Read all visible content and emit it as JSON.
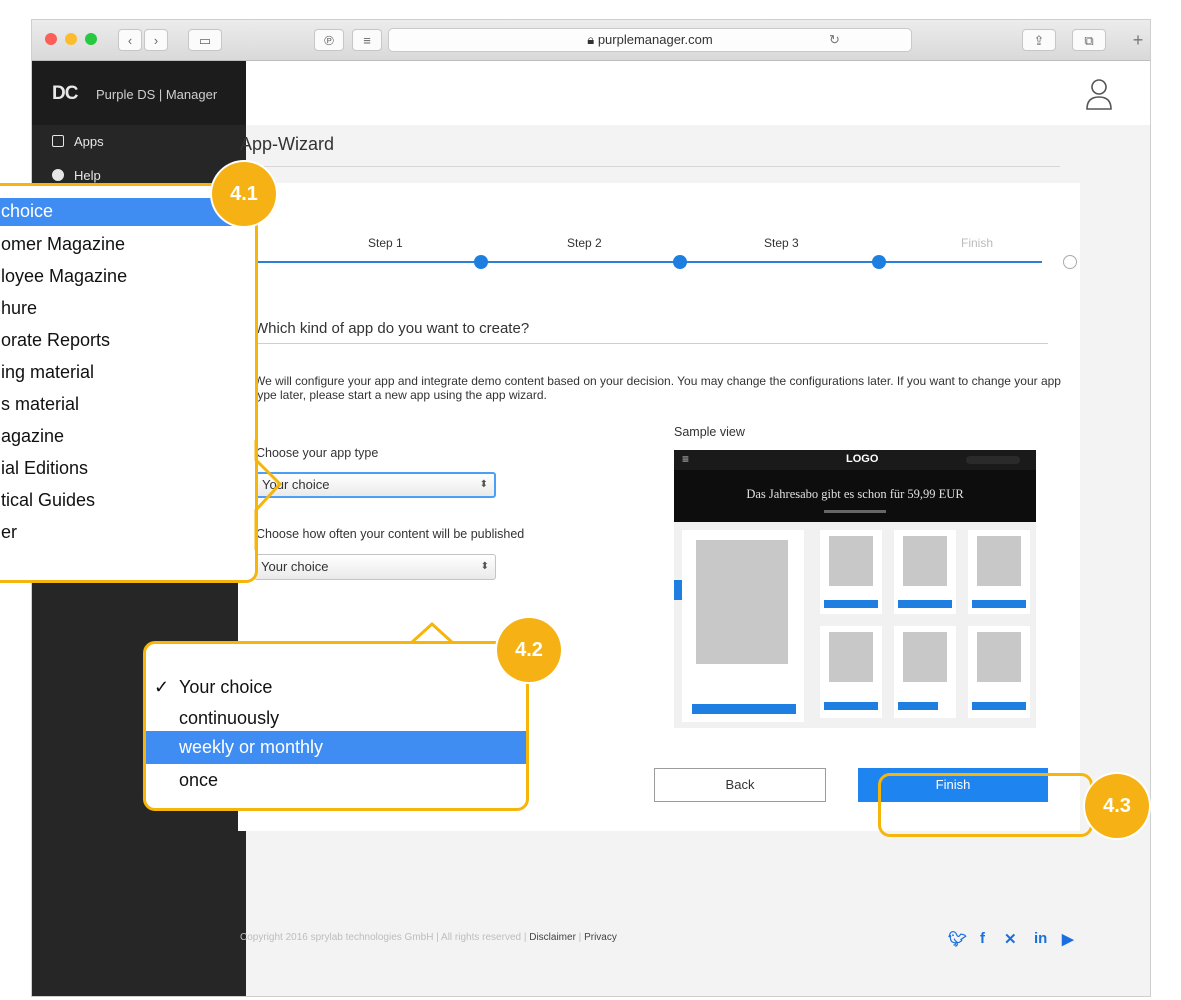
{
  "browser": {
    "url": "purplemanager.com"
  },
  "sidebar": {
    "logo_mark": "DC",
    "logo_text": "Purple DS | Manager",
    "items": [
      {
        "label": "Apps"
      },
      {
        "label": "Help"
      }
    ]
  },
  "main": {
    "title": "App-Wizard",
    "steps": [
      "Step 1",
      "Step 2",
      "Step 3",
      "Finish"
    ],
    "question": "Which kind of app do you want to create?",
    "description": "We will configure your app and integrate demo content based on your decision. You may change the configurations later. If you want to change your app type later, please start a new app using the app wizard.",
    "app_type_label": "Choose your app type",
    "app_type_value": "Your choice",
    "frequency_label": "Choose how often your content will be published",
    "frequency_value": "Your choice",
    "sample_label": "Sample view",
    "sample": {
      "logo": "LOGO",
      "banner": "Das Jahresabo gibt es schon für 59,99 EUR"
    },
    "back_label": "Back",
    "finish_label": "Finish"
  },
  "footer": {
    "copyright": "Copyright 2016 sprylab technologies GmbH | All rights reserved | ",
    "disclaimer": "Disclaimer",
    "separator": " | ",
    "privacy": "Privacy"
  },
  "callout_app_type": {
    "badge": "4.1",
    "options": [
      "choice",
      "omer Magazine",
      "loyee Magazine",
      "hure",
      "orate Reports",
      "ing material",
      "s material",
      "agazine",
      "ial Editions",
      "tical Guides",
      "er"
    ],
    "selected_index": 0
  },
  "callout_frequency": {
    "badge": "4.2",
    "checkmark": "✓",
    "options": [
      "Your choice",
      "continuously",
      "weekly or monthly",
      "once"
    ],
    "checked_index": 0,
    "highlighted_index": 2
  },
  "callout_finish": {
    "badge": "4.3"
  },
  "colors": {
    "accent": "#1d84f0",
    "callout": "#f5b50a",
    "sidebar": "#262626"
  }
}
